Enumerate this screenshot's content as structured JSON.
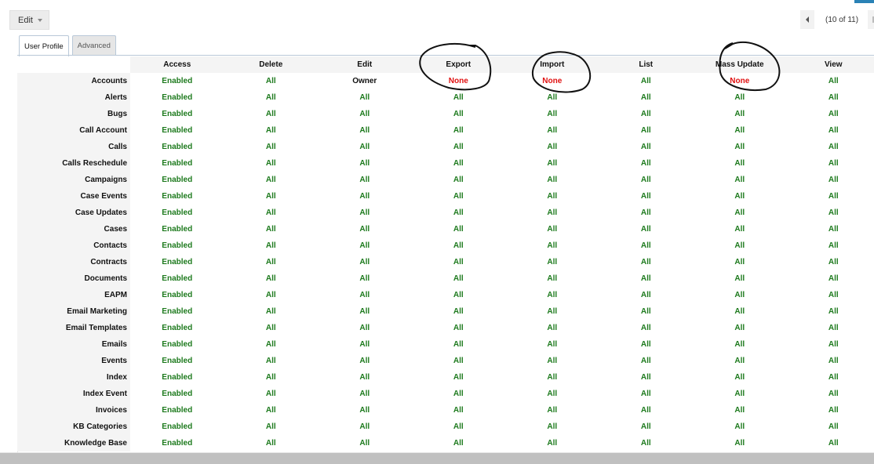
{
  "toolbar": {
    "edit_label": "Edit"
  },
  "pager": {
    "count_text": "(10 of 11)"
  },
  "tabs": [
    {
      "label": "User Profile",
      "active": true
    },
    {
      "label": "Advanced",
      "active": false
    }
  ],
  "grid": {
    "columns": [
      "Access",
      "Delete",
      "Edit",
      "Export",
      "Import",
      "List",
      "Mass Update",
      "View"
    ],
    "status_colors": {
      "Enabled": "#1d7a1d",
      "All": "#1d7a1d",
      "None": "#e01010",
      "Owner": "#111111"
    },
    "rows": [
      {
        "module": "Accounts",
        "values": [
          "Enabled",
          "All",
          "Owner",
          "None",
          "None",
          "All",
          "None",
          "All"
        ]
      },
      {
        "module": "Alerts",
        "values": [
          "Enabled",
          "All",
          "All",
          "All",
          "All",
          "All",
          "All",
          "All"
        ]
      },
      {
        "module": "Bugs",
        "values": [
          "Enabled",
          "All",
          "All",
          "All",
          "All",
          "All",
          "All",
          "All"
        ]
      },
      {
        "module": "Call Account",
        "values": [
          "Enabled",
          "All",
          "All",
          "All",
          "All",
          "All",
          "All",
          "All"
        ]
      },
      {
        "module": "Calls",
        "values": [
          "Enabled",
          "All",
          "All",
          "All",
          "All",
          "All",
          "All",
          "All"
        ]
      },
      {
        "module": "Calls Reschedule",
        "values": [
          "Enabled",
          "All",
          "All",
          "All",
          "All",
          "All",
          "All",
          "All"
        ]
      },
      {
        "module": "Campaigns",
        "values": [
          "Enabled",
          "All",
          "All",
          "All",
          "All",
          "All",
          "All",
          "All"
        ]
      },
      {
        "module": "Case Events",
        "values": [
          "Enabled",
          "All",
          "All",
          "All",
          "All",
          "All",
          "All",
          "All"
        ]
      },
      {
        "module": "Case Updates",
        "values": [
          "Enabled",
          "All",
          "All",
          "All",
          "All",
          "All",
          "All",
          "All"
        ]
      },
      {
        "module": "Cases",
        "values": [
          "Enabled",
          "All",
          "All",
          "All",
          "All",
          "All",
          "All",
          "All"
        ]
      },
      {
        "module": "Contacts",
        "values": [
          "Enabled",
          "All",
          "All",
          "All",
          "All",
          "All",
          "All",
          "All"
        ]
      },
      {
        "module": "Contracts",
        "values": [
          "Enabled",
          "All",
          "All",
          "All",
          "All",
          "All",
          "All",
          "All"
        ]
      },
      {
        "module": "Documents",
        "values": [
          "Enabled",
          "All",
          "All",
          "All",
          "All",
          "All",
          "All",
          "All"
        ]
      },
      {
        "module": "EAPM",
        "values": [
          "Enabled",
          "All",
          "All",
          "All",
          "All",
          "All",
          "All",
          "All"
        ]
      },
      {
        "module": "Email Marketing",
        "values": [
          "Enabled",
          "All",
          "All",
          "All",
          "All",
          "All",
          "All",
          "All"
        ]
      },
      {
        "module": "Email Templates",
        "values": [
          "Enabled",
          "All",
          "All",
          "All",
          "All",
          "All",
          "All",
          "All"
        ]
      },
      {
        "module": "Emails",
        "values": [
          "Enabled",
          "All",
          "All",
          "All",
          "All",
          "All",
          "All",
          "All"
        ]
      },
      {
        "module": "Events",
        "values": [
          "Enabled",
          "All",
          "All",
          "All",
          "All",
          "All",
          "All",
          "All"
        ]
      },
      {
        "module": "Index",
        "values": [
          "Enabled",
          "All",
          "All",
          "All",
          "All",
          "All",
          "All",
          "All"
        ]
      },
      {
        "module": "Index Event",
        "values": [
          "Enabled",
          "All",
          "All",
          "All",
          "All",
          "All",
          "All",
          "All"
        ]
      },
      {
        "module": "Invoices",
        "values": [
          "Enabled",
          "All",
          "All",
          "All",
          "All",
          "All",
          "All",
          "All"
        ]
      },
      {
        "module": "KB Categories",
        "values": [
          "Enabled",
          "All",
          "All",
          "All",
          "All",
          "All",
          "All",
          "All"
        ]
      },
      {
        "module": "Knowledge Base",
        "values": [
          "Enabled",
          "All",
          "All",
          "All",
          "All",
          "All",
          "All",
          "All"
        ]
      }
    ]
  },
  "annotations": [
    {
      "target": "Export"
    },
    {
      "target": "Import"
    },
    {
      "target": "Mass Update"
    }
  ]
}
